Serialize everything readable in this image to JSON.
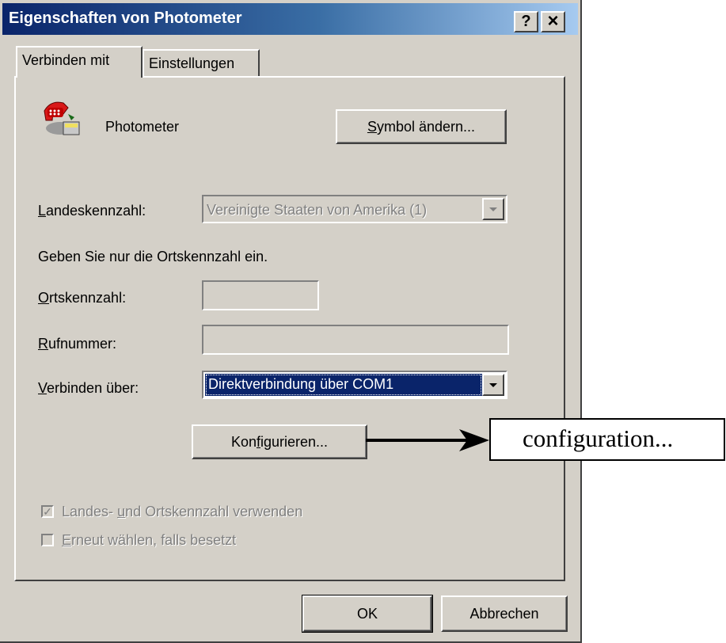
{
  "window": {
    "title": "Eigenschaften von Photometer",
    "help_button": "?",
    "close_button": "×"
  },
  "tabs": [
    {
      "label": "Verbinden mit",
      "active": true
    },
    {
      "label": "Einstellungen",
      "active": false
    }
  ],
  "connection": {
    "name": "Photometer",
    "change_icon_button": {
      "mnemonic": "S",
      "rest": "ymbol ändern..."
    }
  },
  "country_code": {
    "label_mnemonic": "L",
    "label_rest": "andeskennzahl:",
    "value": "Vereinigte Staaten von Amerika (1)",
    "enabled": false
  },
  "hint": "Geben Sie nur die Ortskennzahl ein.",
  "area_code": {
    "label_mnemonic": "O",
    "label_rest": "rtskennzahl:",
    "value": ""
  },
  "phone_number": {
    "label_mnemonic": "R",
    "label_rest": "ufnummer:",
    "value": ""
  },
  "connect_via": {
    "label_mnemonic": "V",
    "label_rest": "erbinden über:",
    "value": "Direktverbindung über COM1"
  },
  "configure_button": {
    "before": "Kon",
    "mnemonic": "f",
    "after": "igurieren..."
  },
  "checkboxes": [
    {
      "before": "Landes- ",
      "mnemonic": "u",
      "after": "nd Ortskennzahl verwenden",
      "checked": true,
      "enabled": false
    },
    {
      "before": "",
      "mnemonic": "E",
      "after": "rneut wählen, falls besetzt",
      "checked": false,
      "enabled": false
    }
  ],
  "footer": {
    "ok": "OK",
    "cancel": "Abbrechen"
  },
  "annotation": {
    "text": "configuration..."
  },
  "colors": {
    "titlebar_start": "#0a246a",
    "titlebar_end": "#a6caf0",
    "face": "#d4d0c8",
    "selection": "#0a246a"
  }
}
